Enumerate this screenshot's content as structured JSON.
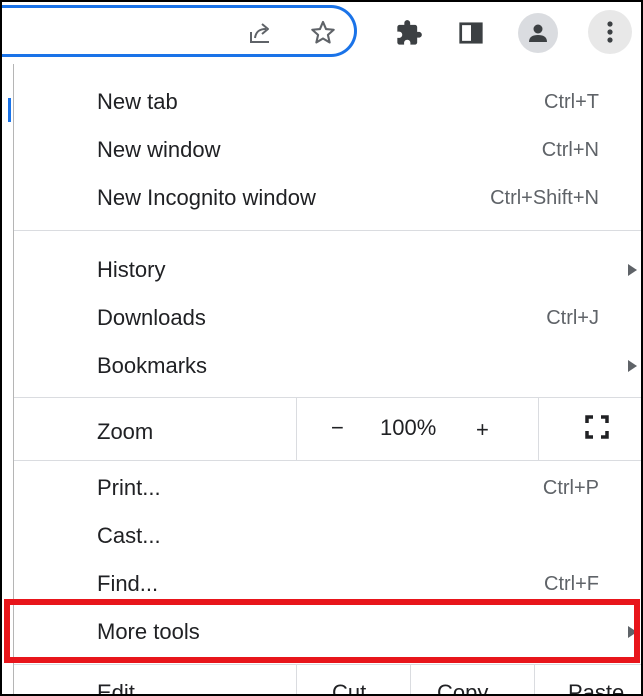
{
  "toolbar": {
    "icons": [
      "share-icon",
      "star-icon",
      "extensions-icon",
      "side-panel-icon",
      "profile-icon",
      "more-icon"
    ]
  },
  "menu": {
    "new_tab": {
      "label": "New tab",
      "shortcut": "Ctrl+T"
    },
    "new_window": {
      "label": "New window",
      "shortcut": "Ctrl+N"
    },
    "new_incognito": {
      "label": "New Incognito window",
      "shortcut": "Ctrl+Shift+N"
    },
    "history": {
      "label": "History"
    },
    "downloads": {
      "label": "Downloads",
      "shortcut": "Ctrl+J"
    },
    "bookmarks": {
      "label": "Bookmarks"
    },
    "zoom": {
      "label": "Zoom",
      "minus": "−",
      "value": "100%",
      "plus": "+"
    },
    "print": {
      "label": "Print...",
      "shortcut": "Ctrl+P"
    },
    "cast": {
      "label": "Cast..."
    },
    "find": {
      "label": "Find...",
      "shortcut": "Ctrl+F"
    },
    "more_tools": {
      "label": "More tools"
    },
    "edit": {
      "label": "Edit",
      "cut": "Cut",
      "copy": "Copy",
      "paste": "Paste"
    }
  },
  "colors": {
    "highlight": "#e8151b",
    "omnibox_focus": "#1a73e8",
    "text": "#202124",
    "secondary_text": "#5f6368"
  }
}
